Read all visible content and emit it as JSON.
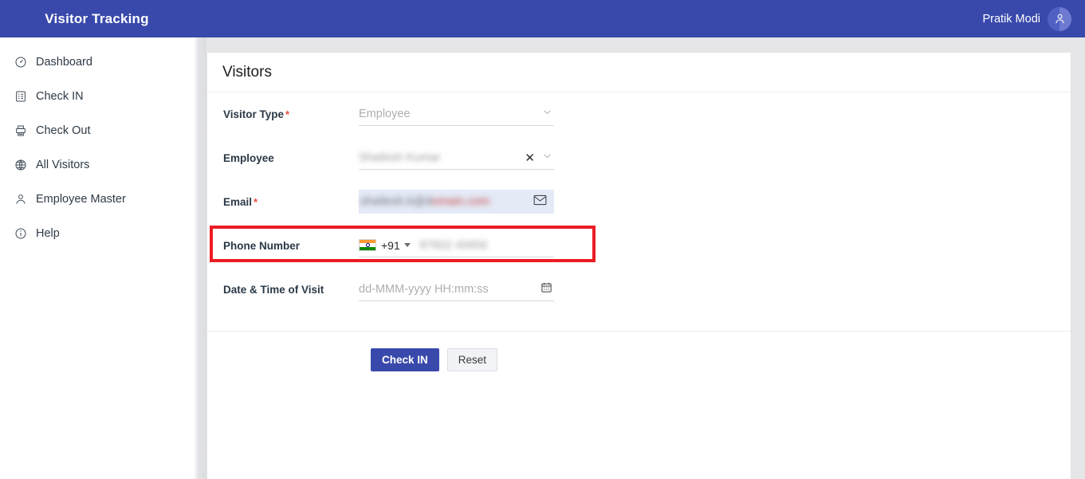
{
  "app": {
    "brand": "Visitor Tracking",
    "accent_color": "#3949ab",
    "page_bg": "#e6e6e8"
  },
  "topbar": {
    "user_name": "Pratik Modi",
    "avatar_icon": "user-avatar-icon"
  },
  "sidebar": {
    "items": [
      {
        "label": "Dashboard",
        "icon": "dashboard-gauge-icon"
      },
      {
        "label": "Check IN",
        "icon": "clipboard-list-icon"
      },
      {
        "label": "Check Out",
        "icon": "printer-exit-icon"
      },
      {
        "label": "All Visitors",
        "icon": "globe-icon"
      },
      {
        "label": "Employee Master",
        "icon": "person-icon"
      },
      {
        "label": "Help",
        "icon": "info-circle-icon"
      }
    ]
  },
  "card": {
    "title": "Visitors"
  },
  "form": {
    "visitor_type": {
      "label": "Visitor Type",
      "required": true,
      "placeholder": "Employee",
      "value": "",
      "icon": "chevron-down-icon"
    },
    "employee": {
      "label": "Employee",
      "required": false,
      "value": "Shailesh Kumar",
      "value_redacted": true,
      "clear_icon": "clear-x-icon",
      "dropdown_icon": "chevron-down-icon"
    },
    "email": {
      "label": "Email",
      "required": true,
      "value": "shailesh.k@domain.com",
      "value_redacted": true,
      "icon": "envelope-icon",
      "highlighted": true,
      "highlight_color": "#ec1c24",
      "field_bg": "#e4eaf6"
    },
    "phone": {
      "label": "Phone Number",
      "required": false,
      "country_flag": "india-flag-icon",
      "country_code": "+91",
      "dropdown_icon": "caret-down-icon",
      "value": "87602 40656",
      "value_redacted": true
    },
    "visit_datetime": {
      "label": "Date & Time of Visit",
      "required": false,
      "placeholder": "dd-MMM-yyyy HH:mm:ss",
      "value": "",
      "icon": "calendar-icon"
    }
  },
  "actions": {
    "submit_label": "Check IN",
    "reset_label": "Reset"
  }
}
